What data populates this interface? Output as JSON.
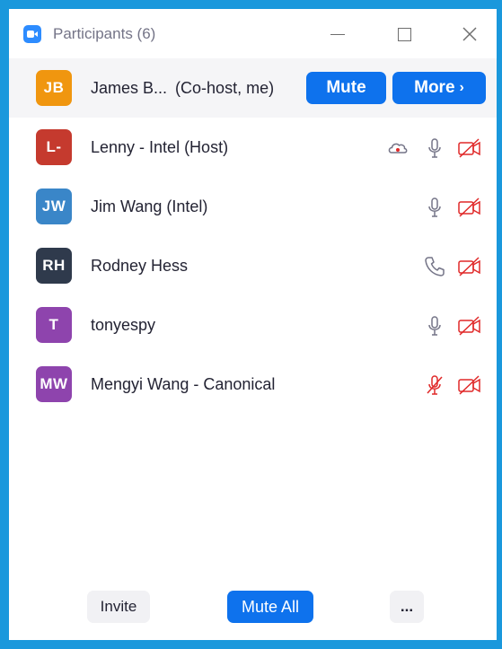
{
  "window": {
    "title": "Participants (6)",
    "app_icon": "zoom-camera-icon",
    "controls": [
      "minimize-icon",
      "maximize-icon",
      "close-icon"
    ]
  },
  "colors": {
    "frame": "#1a98dc",
    "accent": "#0e72ed",
    "muted_red": "#e02828",
    "icon_gray": "#747487"
  },
  "participants": [
    {
      "initials": "JB",
      "avatar_color": "#f0960f",
      "name": "James B...",
      "role": "(Co-host, me)",
      "mute_label": "Mute",
      "more_label": "More",
      "more_chevron": "›"
    },
    {
      "initials": "L-",
      "avatar_color": "#c53a2e",
      "name": "Lenny - Intel (Host)",
      "icons": [
        "cloud-recording-icon",
        "microphone-icon",
        "video-off-icon"
      ]
    },
    {
      "initials": "JW",
      "avatar_color": "#3a86c8",
      "name": "Jim Wang (Intel)",
      "icons": [
        "microphone-icon",
        "video-off-icon"
      ]
    },
    {
      "initials": "RH",
      "avatar_color": "#2f3a4c",
      "name": "Rodney Hess",
      "icons": [
        "phone-icon",
        "video-off-icon"
      ]
    },
    {
      "initials": "T",
      "avatar_color": "#8e44ad",
      "name": "tonyespy",
      "icons": [
        "microphone-icon",
        "video-off-icon"
      ]
    },
    {
      "initials": "MW",
      "avatar_color": "#8e44ad",
      "name": "Mengyi Wang - Canonical",
      "icons": [
        "microphone-muted-icon",
        "video-off-icon"
      ]
    }
  ],
  "footer": {
    "invite_label": "Invite",
    "mute_all_label": "Mute All",
    "more_label": "..."
  }
}
